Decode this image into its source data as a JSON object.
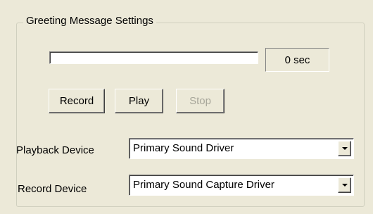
{
  "group": {
    "title": "Greeting Message Settings"
  },
  "recording": {
    "progress_percent": 0,
    "duration_text": "0 sec"
  },
  "buttons": {
    "record_label": "Record",
    "play_label": "Play",
    "stop_label": "Stop",
    "stop_enabled": false
  },
  "playback_device": {
    "label": "Playback Device",
    "selected": "Primary Sound Driver"
  },
  "record_device": {
    "label": "Record Device",
    "selected": "Primary Sound Capture Driver"
  },
  "colors": {
    "background": "#ece9d8",
    "disabled_text": "#a7a69a",
    "field_background": "#ffffff"
  }
}
